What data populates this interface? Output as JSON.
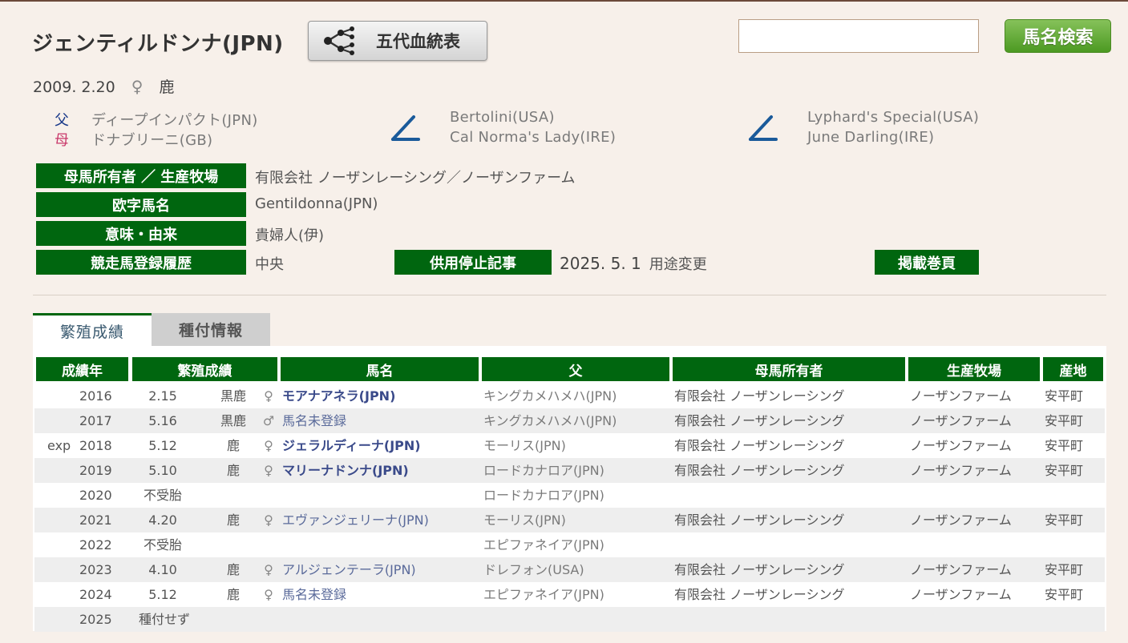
{
  "horse": {
    "name": "ジェンティルドンナ(JPN)",
    "birth_date": "2009. 2.20",
    "sex_symbol": "♀",
    "color": "鹿"
  },
  "pedigree_button": {
    "label": "五代血統表",
    "icon": "pedigree-tree-icon"
  },
  "search": {
    "value": "",
    "button_label": "馬名検索"
  },
  "parents": {
    "sire_key": "父",
    "dam_key": "母",
    "sire": "ディープインパクト(JPN)",
    "dam": "ドナブリーニ(GB)",
    "dam_sire": "Bertolini(USA)",
    "dam_dam": "Cal Norma's Lady(IRE)",
    "dam_dam_sire": "Lyphard's Special(USA)",
    "dam_dam_dam": "June Darling(IRE)",
    "sire_key_color": "#1a3a8a",
    "dam_key_color": "#c8386a",
    "slash_color": "#1a5a9a"
  },
  "info": {
    "owner_label": "母馬所有者 ／ 生産牧場",
    "owner_value": "有限会社 ノーザンレーシング／ノーザンファーム",
    "roman_label": "欧字馬名",
    "roman_value": "Gentildonna(JPN)",
    "meaning_label": "意味・由来",
    "meaning_value": "貴婦人(伊)",
    "registry_label": "競走馬登録履歴",
    "registry_value": "中央",
    "retire_label": "供用停止記事",
    "retire_date": "2025. 5. 1",
    "retire_reason": "用途変更",
    "page_label": "掲載巻頁"
  },
  "tabs": {
    "breeding": "繁殖成績",
    "stud": "種付情報"
  },
  "table": {
    "headers": [
      "成績年",
      "繁殖成績",
      "馬名",
      "父",
      "母馬所有者",
      "生産牧場",
      "産地"
    ],
    "rows": [
      {
        "prefix": "",
        "year": "2016",
        "date": "2.15",
        "color": "黒鹿",
        "sex": "♀",
        "name": "モアナアネラ(JPN)",
        "sire": "キングカメハメハ(JPN)",
        "owner": "有限会社 ノーザンレーシング",
        "farm": "ノーザンファーム",
        "area": "安平町"
      },
      {
        "prefix": "",
        "year": "2017",
        "date": "5.16",
        "color": "黒鹿",
        "sex": "♂",
        "name": "馬名未登録",
        "sire": "キングカメハメハ(JPN)",
        "owner": "有限会社 ノーザンレーシング",
        "farm": "ノーザンファーム",
        "area": "安平町"
      },
      {
        "prefix": "exp",
        "year": "2018",
        "date": "5.12",
        "color": "鹿",
        "sex": "♀",
        "name": "ジェラルディーナ(JPN)",
        "sire": "モーリス(JPN)",
        "owner": "有限会社 ノーザンレーシング",
        "farm": "ノーザンファーム",
        "area": "安平町"
      },
      {
        "prefix": "",
        "year": "2019",
        "date": "5.10",
        "color": "鹿",
        "sex": "♀",
        "name": "マリーナドンナ(JPN)",
        "sire": "ロードカナロア(JPN)",
        "owner": "有限会社 ノーザンレーシング",
        "farm": "ノーザンファーム",
        "area": "安平町"
      },
      {
        "prefix": "",
        "year": "2020",
        "date": "不受胎",
        "color": "",
        "sex": "",
        "name": "",
        "sire": "ロードカナロア(JPN)",
        "owner": "",
        "farm": "",
        "area": ""
      },
      {
        "prefix": "",
        "year": "2021",
        "date": "4.20",
        "color": "鹿",
        "sex": "♀",
        "name": "エヴァンジェリーナ(JPN)",
        "sire": "モーリス(JPN)",
        "owner": "有限会社 ノーザンレーシング",
        "farm": "ノーザンファーム",
        "area": "安平町"
      },
      {
        "prefix": "",
        "year": "2022",
        "date": "不受胎",
        "color": "",
        "sex": "",
        "name": "",
        "sire": "エピファネイア(JPN)",
        "owner": "",
        "farm": "",
        "area": ""
      },
      {
        "prefix": "",
        "year": "2023",
        "date": "4.10",
        "color": "鹿",
        "sex": "♀",
        "name": "アルジェンテーラ(JPN)",
        "sire": "ドレフォン(USA)",
        "owner": "有限会社 ノーザンレーシング",
        "farm": "ノーザンファーム",
        "area": "安平町"
      },
      {
        "prefix": "",
        "year": "2024",
        "date": "5.12",
        "color": "鹿",
        "sex": "♀",
        "name": "馬名未登録",
        "sire": "エピファネイア(JPN)",
        "owner": "有限会社 ノーザンレーシング",
        "farm": "ノーザンファーム",
        "area": "安平町"
      },
      {
        "prefix": "",
        "year": "2025",
        "date": "種付せず",
        "color": "",
        "sex": "",
        "name": "",
        "sire": "",
        "owner": "",
        "farm": "",
        "area": ""
      }
    ]
  },
  "colors": {
    "accent_green": "#00660f",
    "page_bg": "#f7f0ea"
  }
}
